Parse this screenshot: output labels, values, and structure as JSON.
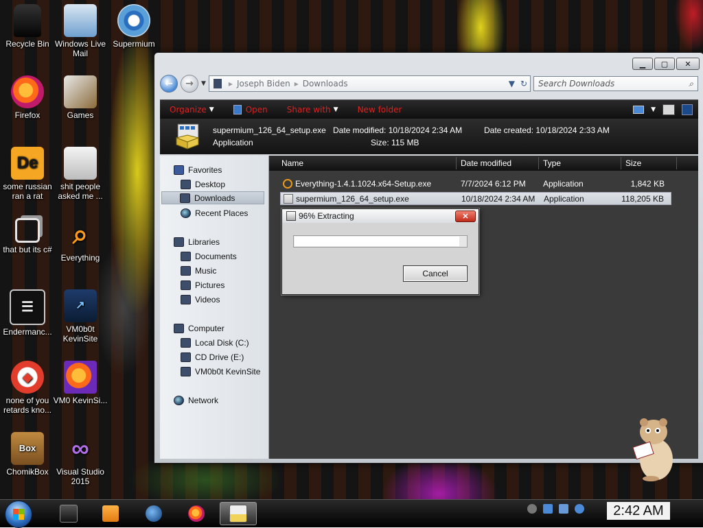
{
  "desktop": {
    "icons": [
      {
        "label": "Recycle Bin",
        "icon": "recycle-bin-icon"
      },
      {
        "label": "Windows Live Mail",
        "icon": "windows-live-mail-icon"
      },
      {
        "label": "Supermium",
        "icon": "supermium-icon"
      },
      {
        "label": "Firefox",
        "icon": "firefox-icon"
      },
      {
        "label": "Games",
        "icon": "games-icon"
      },
      {
        "label": "some russian ran a rat",
        "icon": "de-app-icon"
      },
      {
        "label": "shit people asked me ...",
        "icon": "document-icon"
      },
      {
        "label": "that but its c#",
        "icon": "copy-windows-icon"
      },
      {
        "label": "Everything",
        "icon": "everything-search-icon"
      },
      {
        "label": "Endermanc...",
        "icon": "terminal-icon"
      },
      {
        "label": "VM0b0t KevinSite",
        "icon": "vm-shortcut-icon"
      },
      {
        "label": "none of you retards kno...",
        "icon": "rat-app-icon"
      },
      {
        "label": "VM0 KevinSi...",
        "icon": "firefox-file-icon"
      },
      {
        "label": "ChomikBox",
        "icon": "chomikbox-icon"
      },
      {
        "label": "Visual Studio 2015",
        "icon": "visual-studio-icon"
      }
    ],
    "de_glyph": "De",
    "chomik_glyph": "Box"
  },
  "explorer": {
    "caption": {
      "minimize": "▁",
      "maximize": "▢",
      "close": "✕"
    },
    "breadcrumb": [
      "Joseph Biden",
      "Downloads"
    ],
    "search_placeholder": "Search Downloads",
    "toolbar": {
      "organize": "Organize",
      "open": "Open",
      "share_with": "Share with",
      "new_folder": "New folder"
    },
    "details": {
      "file_name": "supermium_126_64_setup.exe",
      "file_type": "Application",
      "date_modified_label": "Date modified:",
      "date_modified": "10/18/2024 2:34 AM",
      "size_label": "Size:",
      "size": "115 MB",
      "date_created_label": "Date created:",
      "date_created": "10/18/2024 2:33 AM"
    },
    "nav": {
      "favorites": "Favorites",
      "desktop": "Desktop",
      "downloads": "Downloads",
      "recent_places": "Recent Places",
      "libraries": "Libraries",
      "documents": "Documents",
      "music": "Music",
      "pictures": "Pictures",
      "videos": "Videos",
      "computer": "Computer",
      "local_disk": "Local Disk (C:)",
      "cd_drive": "CD Drive (E:)",
      "vm_share": "VM0b0t KevinSite",
      "network": "Network"
    },
    "columns": {
      "name": "Name",
      "date_modified": "Date modified",
      "type": "Type",
      "size": "Size"
    },
    "files": [
      {
        "name": "Everything-1.4.1.1024.x64-Setup.exe",
        "date": "7/7/2024 6:12 PM",
        "type": "Application",
        "size": "1,842 KB"
      },
      {
        "name": "supermium_126_64_setup.exe",
        "date": "10/18/2024 2:34 AM",
        "type": "Application",
        "size": "118,205 KB"
      }
    ]
  },
  "dialog": {
    "title": "96% Extracting",
    "close": "✕",
    "progress_percent": 96,
    "cancel": "Cancel"
  },
  "taskbar": {
    "clock": "2:42 AM",
    "buttons": [
      "file-manager-icon",
      "media-player-icon",
      "supermium-icon",
      "firefox-icon",
      "setup-icon"
    ]
  },
  "colors": {
    "toolbar_text": "#e02020",
    "selection": "#c9cfd6"
  }
}
